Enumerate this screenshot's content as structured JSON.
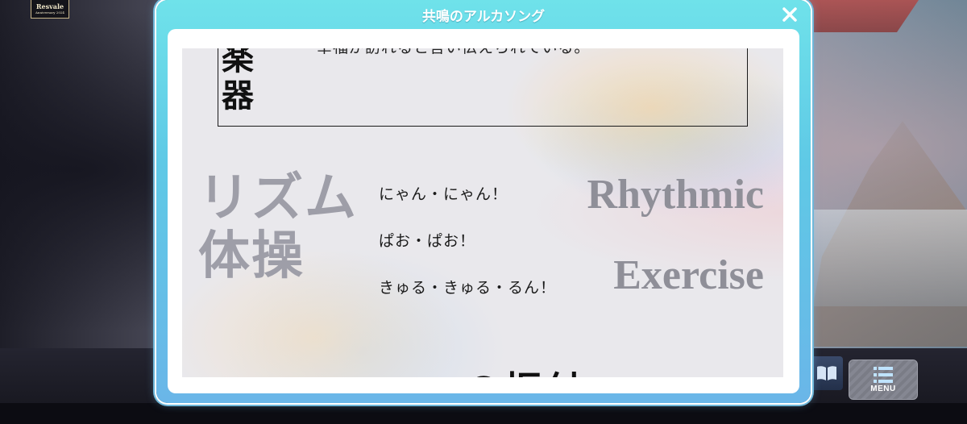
{
  "dialog": {
    "title": "共鳴のアルカソング",
    "close_icon": "close-icon"
  },
  "page": {
    "info_box": {
      "kanji_lines": [
        "楽",
        "器"
      ],
      "text": "幸福が訪れると言い伝えられている。"
    },
    "title_jp_lines": [
      "リズム",
      "体操"
    ],
    "chants": [
      "にゃん・にゃん！",
      "ぱお・ぱお！",
      "きゅる・きゅる・るん！"
    ],
    "title_en_lines": [
      "Rhythmic",
      "Exercise"
    ],
    "next_heading": "の振付"
  },
  "hud": {
    "logo_line1": "Resvale",
    "logo_line2": "Anniversary 2024",
    "book_icon": "book-icon",
    "menu_label": "MENU",
    "menu_icon": "list-icon"
  },
  "colors": {
    "dialog_frame": "#5fc9e6",
    "title_text": "#ffffff",
    "page_bg": "#e9e8ec",
    "title_gray": "#9e9ea8"
  }
}
